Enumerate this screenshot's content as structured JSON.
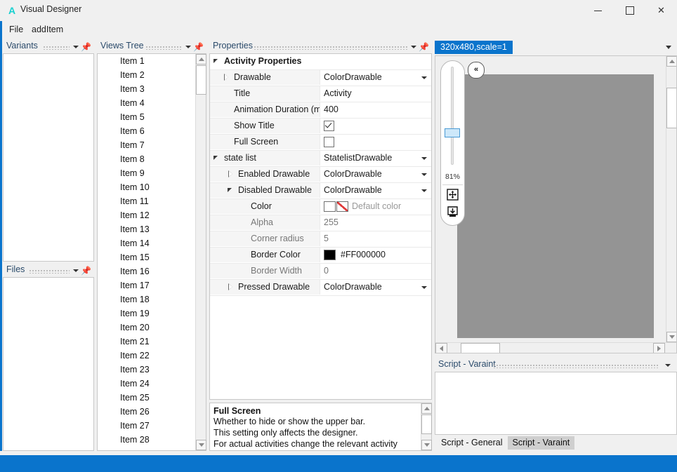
{
  "window": {
    "app_icon": "letter-a-icon",
    "title": "Visual Designer",
    "minimize": "minimize-icon",
    "maximize": "maximize-icon",
    "close": "close-icon"
  },
  "menu": {
    "items": [
      {
        "label": "File"
      },
      {
        "label": "addItem"
      }
    ]
  },
  "variants_panel": {
    "title": "Variants",
    "caret": "chevron-down-icon",
    "pin": "pin-icon"
  },
  "files_panel": {
    "title": "Files",
    "caret": "chevron-down-icon",
    "pin": "pin-icon"
  },
  "views_tree": {
    "title": "Views Tree",
    "caret": "chevron-down-icon",
    "pin": "pin-icon",
    "items": [
      "Item 1",
      "Item 2",
      "Item 3",
      "Item 4",
      "Item 5",
      "Item 6",
      "Item 7",
      "Item 8",
      "Item 9",
      "Item 10",
      "Item 11",
      "Item 12",
      "Item 13",
      "Item 14",
      "Item 15",
      "Item 16",
      "Item 17",
      "Item 18",
      "Item 19",
      "Item 20",
      "Item 21",
      "Item 22",
      "Item 23",
      "Item 24",
      "Item 25",
      "Item 26",
      "Item 27",
      "Item 28"
    ]
  },
  "properties": {
    "title": "Properties",
    "caret": "chevron-down-icon",
    "pin": "pin-icon",
    "rows": [
      {
        "kind": "category",
        "indent": 0,
        "expander": "expanded",
        "name": "Activity Properties",
        "value": ""
      },
      {
        "kind": "combo",
        "indent": 1,
        "expander": "collapsed",
        "name": "Drawable",
        "value": "ColorDrawable"
      },
      {
        "kind": "text",
        "indent": 1,
        "expander": "none",
        "name": "Title",
        "value": "Activity"
      },
      {
        "kind": "text",
        "indent": 1,
        "expander": "none",
        "name": "Animation Duration (ms)",
        "value": "400"
      },
      {
        "kind": "check-on",
        "indent": 1,
        "expander": "none",
        "name": "Show Title",
        "value": ""
      },
      {
        "kind": "check-off",
        "indent": 1,
        "expander": "none",
        "name": "Full Screen",
        "value": ""
      },
      {
        "kind": "combo",
        "indent": 0,
        "expander": "expanded",
        "name": "state list",
        "value": "StatelistDrawable"
      },
      {
        "kind": "combo",
        "indent": 2,
        "expander": "collapsed",
        "name": "Enabled Drawable",
        "value": "ColorDrawable"
      },
      {
        "kind": "combo",
        "indent": 2,
        "expander": "expanded",
        "name": "Disabled Drawable",
        "value": "ColorDrawable"
      },
      {
        "kind": "color-default",
        "indent": 3,
        "expander": "none",
        "name": "Color",
        "value": "Default color"
      },
      {
        "kind": "text-dim",
        "indent": 3,
        "expander": "none",
        "name": "Alpha",
        "value": "255"
      },
      {
        "kind": "text-dim",
        "indent": 3,
        "expander": "none",
        "name": "Corner radius",
        "value": "5"
      },
      {
        "kind": "color-swatch",
        "indent": 3,
        "expander": "none",
        "name": "Border Color",
        "value": "#FF000000",
        "swatch": "#000000"
      },
      {
        "kind": "text-dim",
        "indent": 3,
        "expander": "none",
        "name": "Border Width",
        "value": "0"
      },
      {
        "kind": "combo",
        "indent": 2,
        "expander": "collapsed",
        "name": "Pressed Drawable",
        "value": "ColorDrawable"
      }
    ],
    "description": {
      "title": "Full Screen",
      "lines": [
        "Whether to hide or show the upper bar.",
        "This setting only affects the designer.",
        "For actual activities change the relevant activity"
      ]
    }
  },
  "designer": {
    "tab_label": "320x480,scale=1",
    "tab_caret": "chevron-down-icon",
    "collapse_button": "collapse-left-icon",
    "zoom_value": "81%",
    "pan_icon": "move-arrows-icon",
    "save_icon": "save-download-icon",
    "hscroll_left": "arrow-left-icon",
    "hscroll_right": "arrow-right-icon",
    "vscroll_up": "arrow-up-icon",
    "vscroll_down": "arrow-down-icon"
  },
  "script": {
    "title": "Script - Varaint",
    "caret": "chevron-down-icon",
    "content": "",
    "tabs": [
      {
        "label": "Script - General",
        "active": false
      },
      {
        "label": "Script - Varaint",
        "active": true
      }
    ]
  },
  "colors": {
    "accent": "#0a74cc",
    "panel_bg": "#f0f0f0",
    "device_fill": "#949494",
    "icon_accent": "#17d0d0"
  }
}
